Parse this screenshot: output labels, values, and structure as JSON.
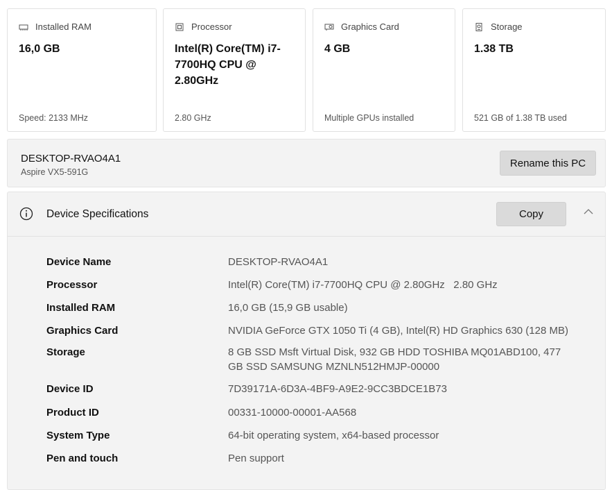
{
  "cards": [
    {
      "icon": "ram-icon",
      "title": "Installed RAM",
      "value": "16,0 GB",
      "sub": "Speed: 2133 MHz"
    },
    {
      "icon": "processor-icon",
      "title": "Processor",
      "value": "Intel(R) Core(TM) i7-7700HQ CPU @ 2.80GHz",
      "sub": "2.80 GHz"
    },
    {
      "icon": "graphics-card-icon",
      "title": "Graphics Card",
      "value": "4 GB",
      "sub": "Multiple GPUs installed"
    },
    {
      "icon": "storage-icon",
      "title": "Storage",
      "value": "1.38 TB",
      "sub": "521 GB of 1.38 TB used"
    }
  ],
  "pc": {
    "name": "DESKTOP-RVAO4A1",
    "model": "Aspire VX5-591G",
    "rename_label": "Rename this PC"
  },
  "specs": {
    "title": "Device Specifications",
    "copy_label": "Copy",
    "rows": [
      {
        "label": "Device Name",
        "value": "DESKTOP-RVAO4A1"
      },
      {
        "label": "Processor",
        "value": "Intel(R) Core(TM) i7-7700HQ CPU @ 2.80GHz   2.80 GHz"
      },
      {
        "label": "Installed RAM",
        "value": "16,0 GB (15,9 GB usable)"
      },
      {
        "label": "Graphics Card",
        "value": "NVIDIA GeForce GTX 1050 Ti (4 GB), Intel(R) HD Graphics 630 (128 MB)"
      },
      {
        "label": "Storage",
        "value": "8 GB SSD Msft Virtual Disk, 932 GB HDD TOSHIBA MQ01ABD100, 477 GB SSD SAMSUNG MZNLN512HMJP-00000"
      },
      {
        "label": "Device ID",
        "value": "7D39171A-6D3A-4BF9-A9E2-9CC3BDCE1B73"
      },
      {
        "label": "Product ID",
        "value": "00331-10000-00001-AA568"
      },
      {
        "label": "System Type",
        "value": "64-bit operating system, x64-based processor"
      },
      {
        "label": "Pen and touch",
        "value": "Pen support"
      }
    ]
  }
}
